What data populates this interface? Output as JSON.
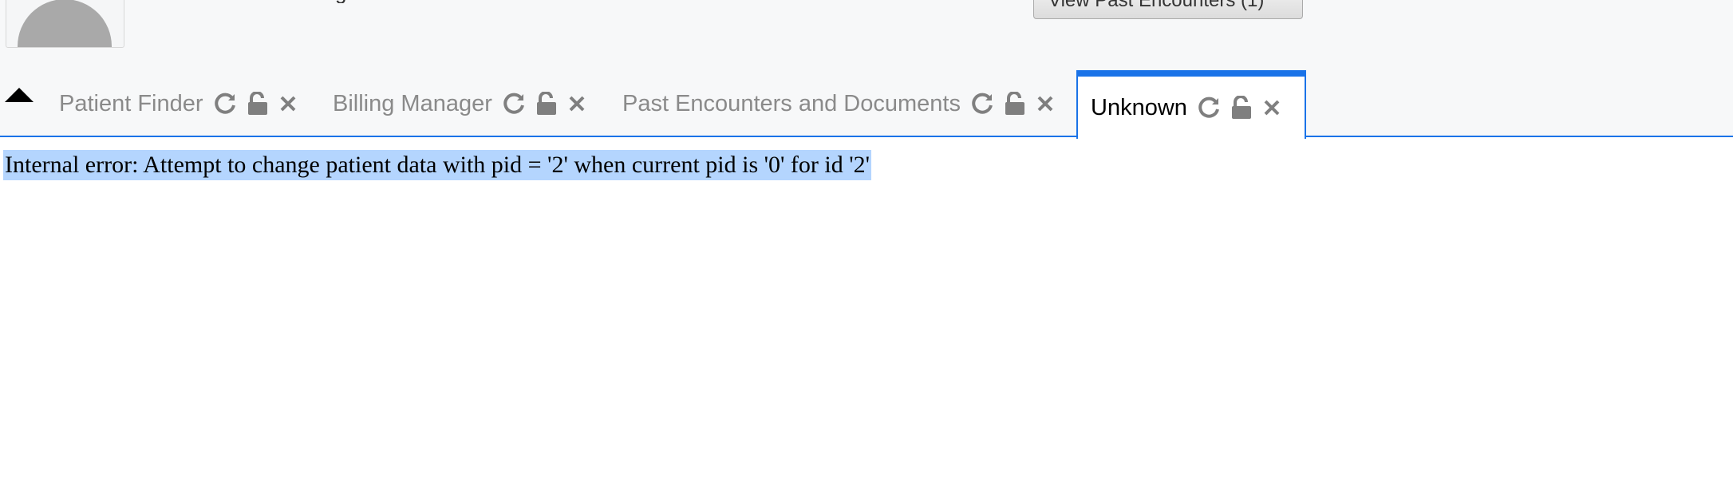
{
  "header": {
    "text_fragment": "g",
    "past_encounters_button": "View Past Encounters  (1)"
  },
  "tabs": [
    {
      "label": "Patient Finder",
      "active": false
    },
    {
      "label": "Billing Manager",
      "active": false
    },
    {
      "label": "Past Encounters and Documents",
      "active": false
    },
    {
      "label": "Unknown",
      "active": true
    }
  ],
  "icons": [
    "refresh-icon",
    "unlock-icon",
    "close-icon"
  ],
  "accent_color": "#1a73e8",
  "selection_color": "#b4d5fe",
  "main": {
    "error_message": "Internal error: Attempt to change patient data with pid = '2' when current pid is '0' for id '2'"
  }
}
